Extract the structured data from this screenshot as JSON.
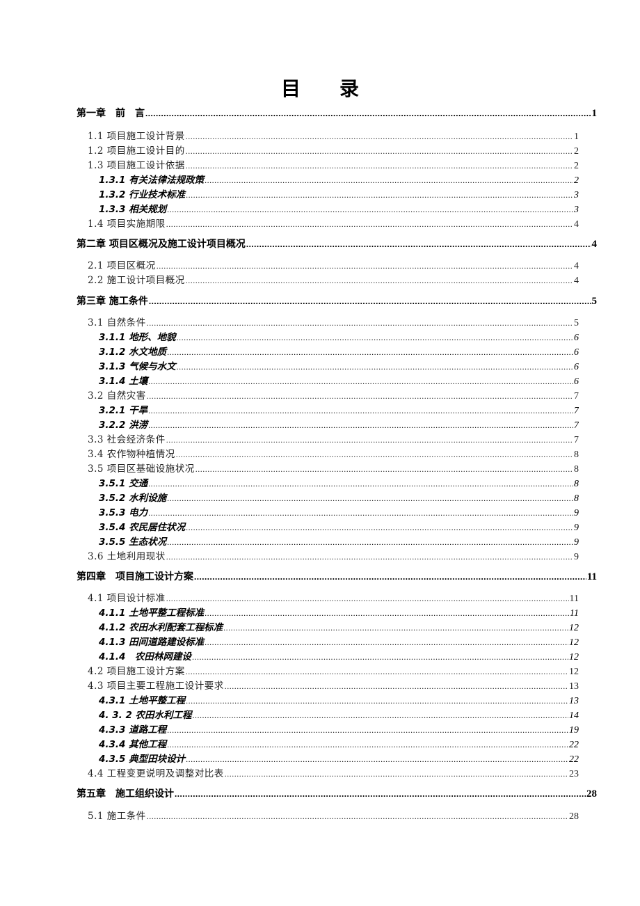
{
  "title": {
    "char1": "目",
    "char2": "录"
  },
  "toc": [
    {
      "level": "chapter",
      "label": "第一章　前　言",
      "page": "1"
    },
    {
      "level": "section",
      "label": "1.1 项目施工设计背景",
      "page": "1"
    },
    {
      "level": "section",
      "label": "1.2 项目施工设计目的",
      "page": "2"
    },
    {
      "level": "section",
      "label": "1.3 项目施工设计依据",
      "page": "2"
    },
    {
      "level": "subsection",
      "label": "1.3.1 有关法律法规政策",
      "page": "2"
    },
    {
      "level": "subsection",
      "label": "1.3.2 行业技术标准",
      "page": "3"
    },
    {
      "level": "subsection",
      "label": "1.3.3 相关规划",
      "page": "3"
    },
    {
      "level": "section",
      "label": "1.4 项目实施期限",
      "page": "4"
    },
    {
      "level": "chapter",
      "label": "第二章  项目区概况及施工设计项目概况",
      "page": "4"
    },
    {
      "level": "section",
      "label": "2.1 项目区概况",
      "page": "4"
    },
    {
      "level": "section",
      "label": "2.2 施工设计项目概况",
      "page": "4"
    },
    {
      "level": "chapter",
      "label": "第三章  施工条件",
      "page": "5"
    },
    {
      "level": "section",
      "label": "3.1 自然条件",
      "page": "5"
    },
    {
      "level": "subsection",
      "label": "3.1.1 地形、地貌",
      "page": "6"
    },
    {
      "level": "subsection",
      "label": "3.1.2 水文地质",
      "page": "6"
    },
    {
      "level": "subsection",
      "label": "3.1.3 气候与水文",
      "page": "6"
    },
    {
      "level": "subsection",
      "label": "3.1.4 土壤",
      "page": "6"
    },
    {
      "level": "section",
      "label": "3.2 自然灾害",
      "page": "7"
    },
    {
      "level": "subsection",
      "label": "3.2.1  干旱",
      "page": "7"
    },
    {
      "level": "subsection",
      "label": "3.2.2 洪涝",
      "page": "7"
    },
    {
      "level": "section",
      "label": "3.3 社会经济条件",
      "page": "7"
    },
    {
      "level": "section",
      "label": "3.4 农作物种植情况",
      "page": "8"
    },
    {
      "level": "section",
      "label": "3.5 项目区基础设施状况",
      "page": "8"
    },
    {
      "level": "subsection",
      "label": "3.5.1  交通",
      "page": "8"
    },
    {
      "level": "subsection",
      "label": "3.5.2  水利设施",
      "page": "8"
    },
    {
      "level": "subsection",
      "label": "3.5.3  电力",
      "page": "9"
    },
    {
      "level": "subsection",
      "label": "3.5.4 农民居住状况",
      "page": "9"
    },
    {
      "level": "subsection",
      "label": "3.5.5 生态状况",
      "page": "9"
    },
    {
      "level": "section",
      "label": "3.6 土地利用现状",
      "page": "9"
    },
    {
      "level": "chapter",
      "label": "第四章　项目施工设计方案",
      "page": "11"
    },
    {
      "level": "section",
      "label": "4.1 项目设计标准",
      "page": "11"
    },
    {
      "level": "subsection",
      "label": "4.1.1 土地平整工程标准",
      "page": "11"
    },
    {
      "level": "subsection",
      "label": "4.1.2 农田水利配套工程标准",
      "page": "12"
    },
    {
      "level": "subsection",
      "label": "4.1.3  田间道路建设标准",
      "page": "12"
    },
    {
      "level": "subsection",
      "label": "4.1.4　农田林网建设",
      "page": "12"
    },
    {
      "level": "section",
      "label": "4.2 项目施工设计方案",
      "page": "12"
    },
    {
      "level": "section",
      "label": "4.3 项目主要工程施工设计要求",
      "page": "13"
    },
    {
      "level": "subsection",
      "label": "4.3.1 土地平整工程",
      "page": "13"
    },
    {
      "level": "subsection",
      "label": "4. 3. 2 农田水利工程",
      "page": "14"
    },
    {
      "level": "subsection",
      "label": "4.3.3  道路工程",
      "page": "19"
    },
    {
      "level": "subsection",
      "label": "4.3.4  其他工程",
      "page": "22"
    },
    {
      "level": "subsection",
      "label": "4.3.5  典型田块设计",
      "page": "22"
    },
    {
      "level": "section",
      "label": "4.4 工程变更说明及调整对比表",
      "page": "23"
    },
    {
      "level": "chapter",
      "label": "第五章　施工组织设计",
      "page": "28"
    },
    {
      "level": "section",
      "label": "5.1 施工条件",
      "page": "28"
    }
  ]
}
